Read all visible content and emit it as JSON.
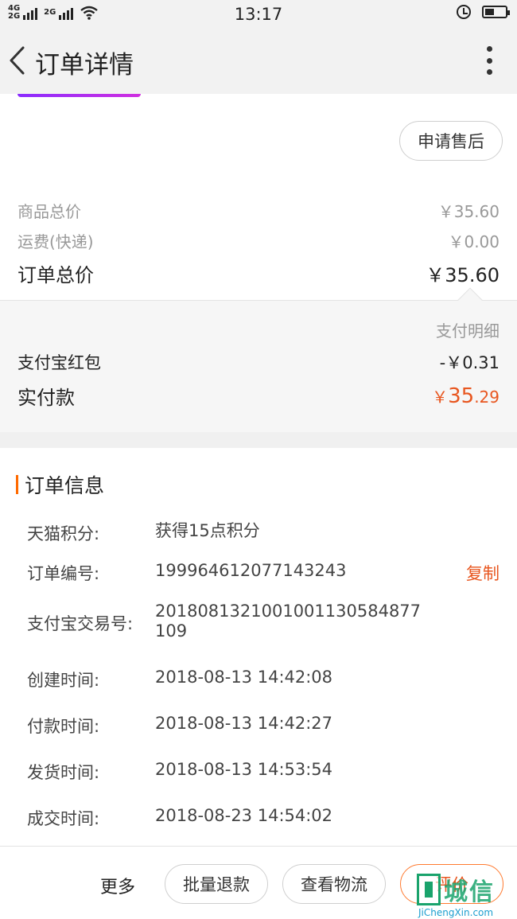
{
  "status_bar": {
    "network_top": "4G",
    "network_bottom": "2G",
    "network2": "2G",
    "time": "13:17"
  },
  "nav": {
    "title": "订单详情"
  },
  "after_sale_button": "申请售后",
  "price_summary": {
    "goods_total_label": "商品总价",
    "goods_total_value": "￥35.60",
    "shipping_label": "运费(快递)",
    "shipping_value": "￥0.00",
    "order_total_label": "订单总价",
    "order_total_value": "￥35.60"
  },
  "payment_detail": {
    "title": "支付明细",
    "red_packet_label": "支付宝红包",
    "red_packet_value": "-￥0.31",
    "actual_paid_label": "实付款",
    "actual_paid_currency": "￥",
    "actual_paid_integer": "35",
    "actual_paid_decimal": ".29",
    "accent_color": "#e8561f"
  },
  "order_info": {
    "title": "订单信息",
    "rows": [
      {
        "label": "天猫积分:",
        "value": "获得15点积分"
      },
      {
        "label": "订单编号:",
        "value": "199964612077143243",
        "action": "复制"
      },
      {
        "label": "支付宝交易号:",
        "value": "20180813210010011305848771​09"
      },
      {
        "label": "创建时间:",
        "value": "2018-08-13 14:42:08"
      },
      {
        "label": "付款时间:",
        "value": "2018-08-13 14:42:27"
      },
      {
        "label": "发货时间:",
        "value": "2018-08-13 14:53:54"
      },
      {
        "label": "成交时间:",
        "value": "2018-08-23 14:54:02"
      }
    ]
  },
  "bottom_bar": {
    "more_label": "更多",
    "refund_button": "批量退款",
    "logistics_button": "查看物流",
    "review_button": "评价"
  },
  "watermark": {
    "title": "城信",
    "subtitle": "JiChengXin.com"
  }
}
